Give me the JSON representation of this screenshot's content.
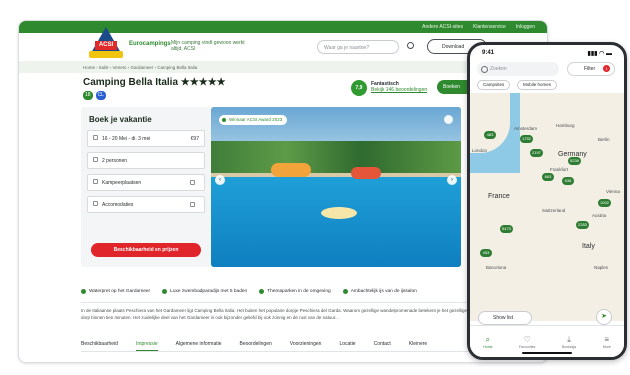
{
  "site": {
    "topbar": [
      "Andere ACSI-sites",
      "Klantenservice",
      "Inloggen"
    ],
    "brand": "Eurocampings",
    "tagline": "Mijn camping vindt gewoon werkt altijd, ACSI",
    "search_placeholder": "Waar ga je naartoe?",
    "download_label": "Download",
    "breadcrumb": "Home › Italië › Veneto › Gardameer › Camping Bella Italia",
    "camp_title": "Camping Bella Italia ★★★★★",
    "badges": [
      {
        "text": "18",
        "color": "#2f8a2f"
      },
      {
        "text": "CL",
        "color": "#2a5fd0"
      }
    ],
    "rating_value": "7,9",
    "rating_label": "Fantastisch",
    "rating_link": "Bekijk 146 beoordelingen",
    "book_top": "Boeken"
  },
  "booking": {
    "title": "Boek je vakantie",
    "fields": [
      {
        "label": "16 - 20 Mei - di. 3 mei",
        "extra": "€97"
      },
      {
        "label": "2 personen",
        "extra": ""
      },
      {
        "label": "Kampeerplaatsen",
        "extra": ""
      },
      {
        "label": "Accomodaties",
        "extra": ""
      }
    ],
    "cta": "Beschikbaarheid en prijzen"
  },
  "hero": {
    "badge": "Winnaar ACSI Award 2023"
  },
  "features": [
    "Waterpret op het Gardameer",
    "Luxe zwembadparadijs met 5 baden",
    "Themaparken in de omgeving",
    "Ambachtelijk ijs van de ijssalon"
  ],
  "description": "In de Italiaanse plaats Peschiera van het Gardameer ligt Camping Bella Italia. Het buiten het populaire dorpje Peschiera del Garda. Waarom gezellige wandelpromenade betekent je het gezellige centrum van het dorp binnen tien minuten. Het zuidelijke deel van het Gardameer is ook bijzonder geliefd bij ook zonnig en de rust van de natuur...",
  "tabs": [
    "Beschikbaarheid",
    "Impressie",
    "Algemene informatie",
    "Beoordelingen",
    "Voorzieningen",
    "Locatie",
    "Contact",
    "Kleinere"
  ],
  "active_tab_index": 1,
  "phone": {
    "time": "9:41",
    "search_placeholder": "Zoeken",
    "filter_label": "Filter",
    "filter_count": "1",
    "chips": [
      "Campsites",
      "Mobile homes",
      "Glamping"
    ],
    "countries": [
      "France",
      "Germany",
      "Italy",
      "Austria",
      "Switzerland"
    ],
    "cities": [
      "London",
      "Amsterdam",
      "Hamburg",
      "Berlin",
      "Frankfurt",
      "Vienna",
      "Barcelona",
      "Naples",
      "Paris"
    ],
    "markers": [
      "483",
      "1752",
      "5239",
      "2197",
      "538",
      "1002",
      "2283",
      "5473",
      "453",
      "663",
      "283",
      "1006"
    ],
    "show_list": "Show list",
    "nav": [
      "Home",
      "Favourites",
      "Bookings",
      "More"
    ]
  }
}
